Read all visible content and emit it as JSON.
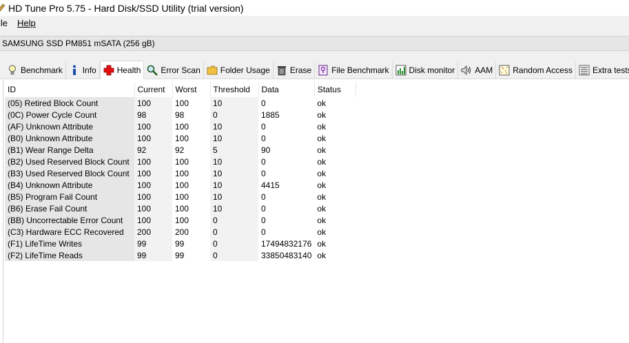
{
  "window": {
    "title": "HD Tune Pro 5.75 - Hard Disk/SSD Utility (trial version)"
  },
  "menu": {
    "file": "ile",
    "help": "Help"
  },
  "drive": {
    "label": "SAMSUNG SSD PM851 mSATA (256 gB)"
  },
  "tabs": [
    {
      "label": "Benchmark",
      "icon": "lightbulb-icon"
    },
    {
      "label": "Info",
      "icon": "info-icon"
    },
    {
      "label": "Health",
      "icon": "health-cross-icon"
    },
    {
      "label": "Error Scan",
      "icon": "magnifier-icon"
    },
    {
      "label": "Folder Usage",
      "icon": "folder-icon"
    },
    {
      "label": "Erase",
      "icon": "trash-icon"
    },
    {
      "label": "File Benchmark",
      "icon": "file-benchmark-icon"
    },
    {
      "label": "Disk monitor",
      "icon": "bar-chart-icon"
    },
    {
      "label": "AAM",
      "icon": "speaker-icon"
    },
    {
      "label": "Random Access",
      "icon": "scatter-icon"
    },
    {
      "label": "Extra tests",
      "icon": "list-icon"
    }
  ],
  "table": {
    "headers": [
      "ID",
      "Current",
      "Worst",
      "Threshold",
      "Data",
      "Status"
    ],
    "rows": [
      [
        "(05) Retired Block Count",
        "100",
        "100",
        "10",
        "0",
        "ok"
      ],
      [
        "(0C) Power Cycle Count",
        "98",
        "98",
        "0",
        "1885",
        "ok"
      ],
      [
        "(AF) Unknown Attribute",
        "100",
        "100",
        "10",
        "0",
        "ok"
      ],
      [
        "(B0) Unknown Attribute",
        "100",
        "100",
        "10",
        "0",
        "ok"
      ],
      [
        "(B1) Wear Range Delta",
        "92",
        "92",
        "5",
        "90",
        "ok"
      ],
      [
        "(B2) Used Reserved Block Count",
        "100",
        "100",
        "10",
        "0",
        "ok"
      ],
      [
        "(B3) Used Reserved Block Count",
        "100",
        "100",
        "10",
        "0",
        "ok"
      ],
      [
        "(B4) Unknown Attribute",
        "100",
        "100",
        "10",
        "4415",
        "ok"
      ],
      [
        "(B5) Program Fail Count",
        "100",
        "100",
        "10",
        "0",
        "ok"
      ],
      [
        "(B6) Erase Fail Count",
        "100",
        "100",
        "10",
        "0",
        "ok"
      ],
      [
        "(BB) Uncorrectable Error Count",
        "100",
        "100",
        "0",
        "0",
        "ok"
      ],
      [
        "(C3) Hardware ECC Recovered",
        "200",
        "200",
        "0",
        "0",
        "ok"
      ],
      [
        "(F1) LifeTime Writes",
        "99",
        "99",
        "0",
        "17494832176",
        "ok"
      ],
      [
        "(F2) LifeTime Reads",
        "99",
        "99",
        "0",
        "33850483140",
        "ok"
      ]
    ]
  }
}
